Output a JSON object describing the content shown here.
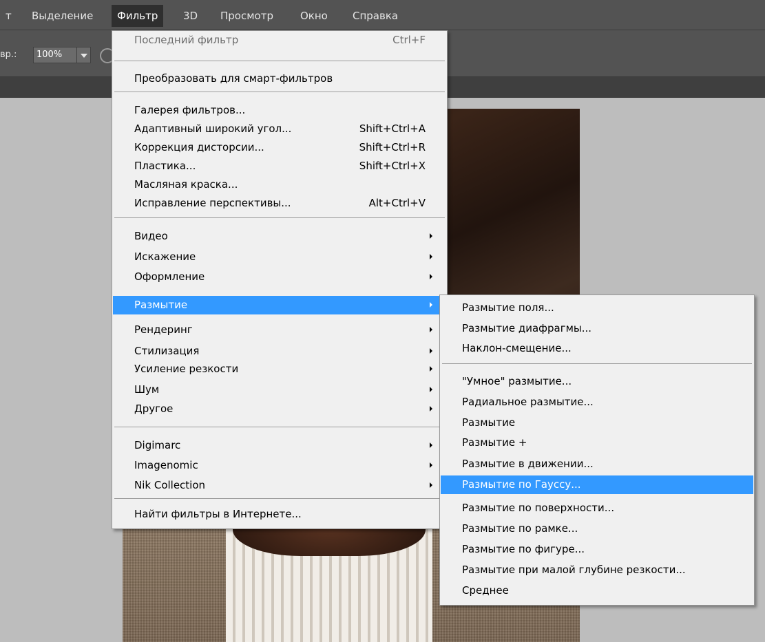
{
  "menubar": {
    "items": [
      "т",
      "Выделение",
      "Фильтр",
      "3D",
      "Просмотр",
      "Окно",
      "Справка"
    ],
    "active": "Фильтр"
  },
  "options": {
    "label": "вр.:",
    "value": "100%"
  },
  "filter_menu": {
    "last_filter": {
      "label": "Последний фильтр",
      "shortcut": "Ctrl+F"
    },
    "convert_smart": {
      "label": "Преобразовать для смарт-фильтров"
    },
    "gallery": {
      "label": "Галерея фильтров..."
    },
    "adaptive_wide": {
      "label": "Адаптивный широкий угол...",
      "shortcut": "Shift+Ctrl+A"
    },
    "lens_correction": {
      "label": "Коррекция дисторсии...",
      "shortcut": "Shift+Ctrl+R"
    },
    "liquify": {
      "label": "Пластика...",
      "shortcut": "Shift+Ctrl+X"
    },
    "oil_paint": {
      "label": "Масляная краска..."
    },
    "vanishing_point": {
      "label": "Исправление перспективы...",
      "shortcut": "Alt+Ctrl+V"
    },
    "video": {
      "label": "Видео"
    },
    "distort": {
      "label": "Искажение"
    },
    "design": {
      "label": "Оформление"
    },
    "blur": {
      "label": "Размытие"
    },
    "render": {
      "label": "Рендеринг"
    },
    "stylize": {
      "label": "Стилизация"
    },
    "sharpen": {
      "label": "Усиление резкости"
    },
    "noise": {
      "label": "Шум"
    },
    "other": {
      "label": "Другое"
    },
    "digimarc": {
      "label": "Digimarc"
    },
    "imagenomic": {
      "label": "Imagenomic"
    },
    "nik": {
      "label": "Nik Collection"
    },
    "browse_online": {
      "label": "Найти фильтры в Интернете..."
    }
  },
  "blur_menu": {
    "field_blur": "Размытие поля...",
    "iris_blur": "Размытие диафрагмы...",
    "tilt_shift": "Наклон-смещение...",
    "smart_blur": "\"Умное\" размытие...",
    "radial_blur": "Радиальное размытие...",
    "blur": "Размытие",
    "blur_more": "Размытие +",
    "motion_blur": "Размытие в движении...",
    "gaussian_blur": "Размытие по Гауссу...",
    "surface_blur": "Размытие по поверхности...",
    "box_blur": "Размытие по рамке...",
    "shape_blur": "Размытие по фигуре...",
    "lens_blur": "Размытие при малой глубине резкости...",
    "average": "Среднее"
  },
  "colors": {
    "highlight": "#3399ff",
    "menu_bg": "#f0f0f0",
    "app_bar": "#535353",
    "workspace": "#bdbdbd"
  }
}
